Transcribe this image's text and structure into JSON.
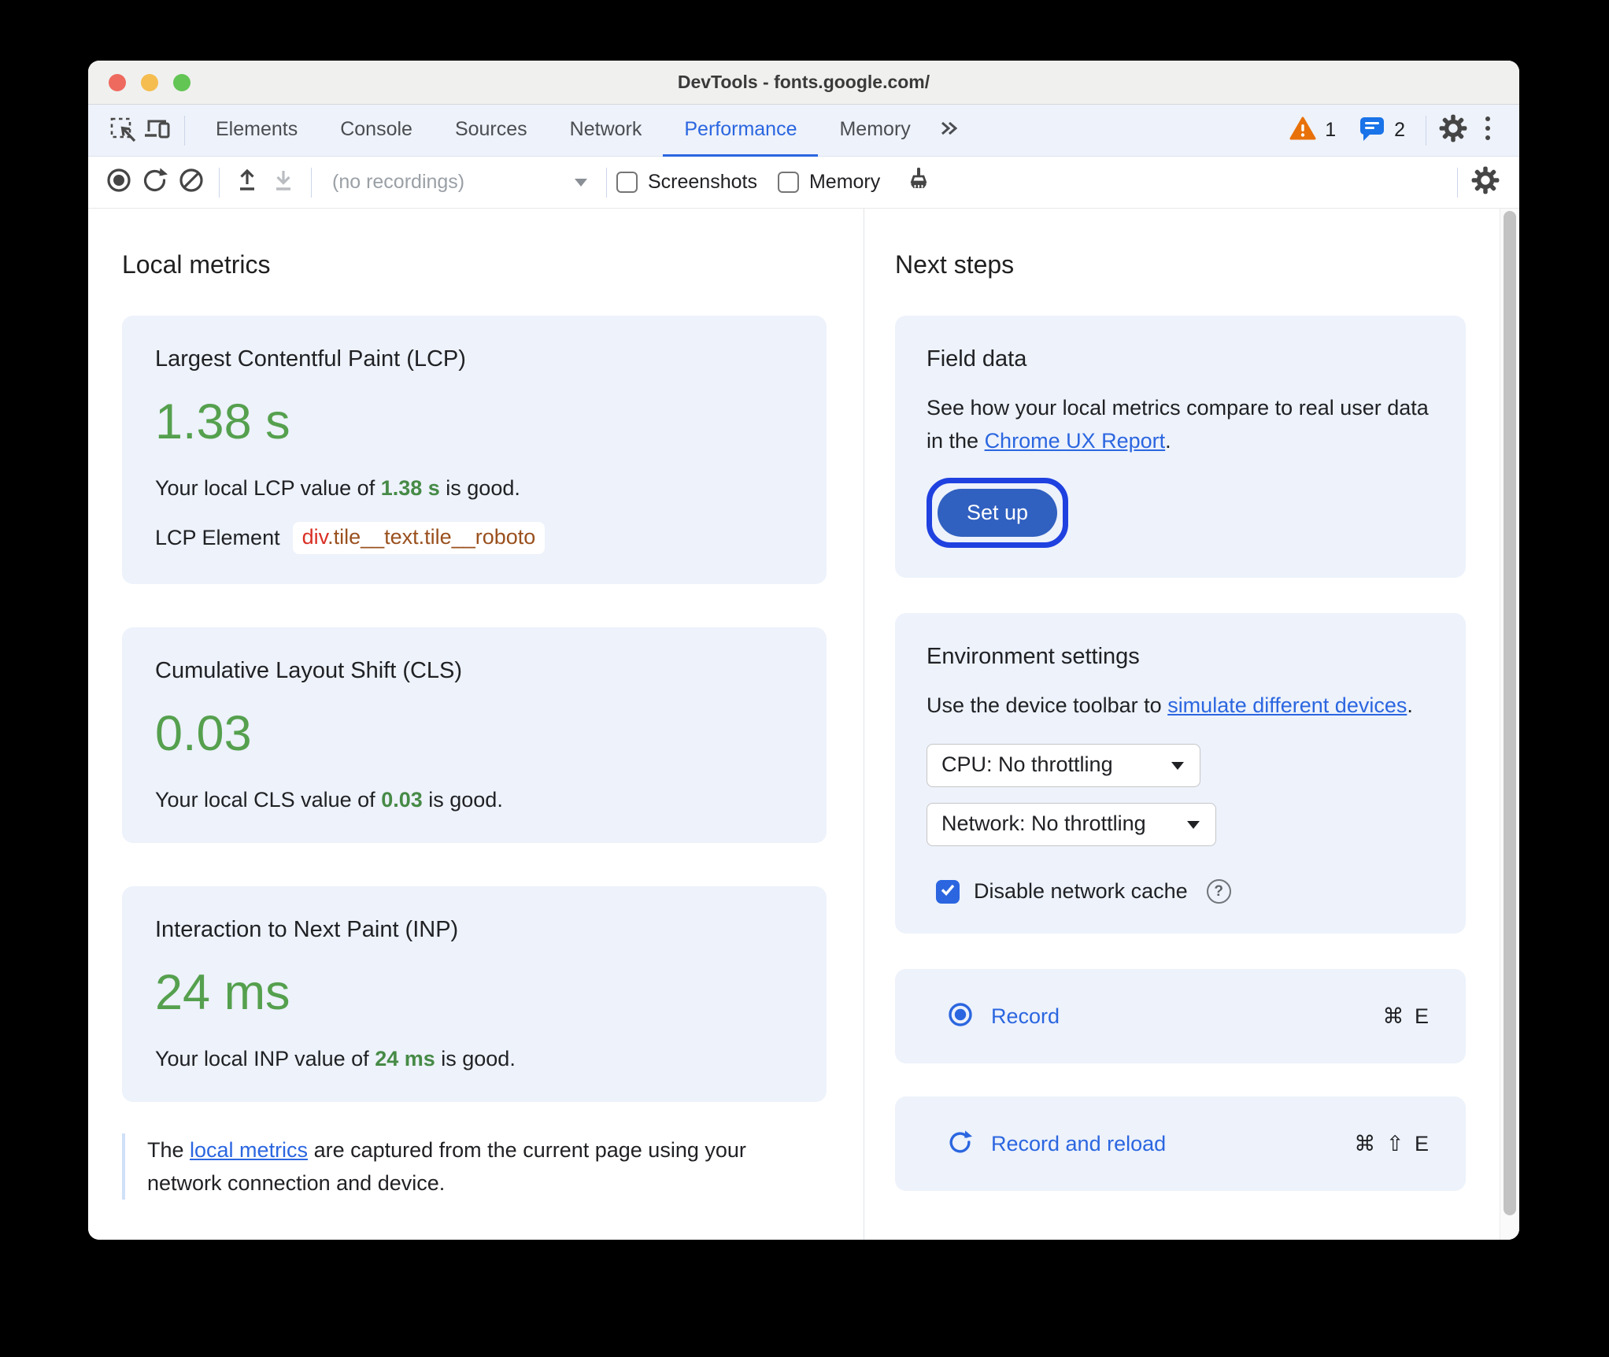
{
  "window": {
    "title": "DevTools - fonts.google.com/"
  },
  "tabbar": {
    "tabs": [
      {
        "label": "Elements"
      },
      {
        "label": "Console"
      },
      {
        "label": "Sources"
      },
      {
        "label": "Network"
      },
      {
        "label": "Performance"
      },
      {
        "label": "Memory"
      }
    ],
    "active_tab": "Performance",
    "warning_count": "1",
    "message_count": "2"
  },
  "toolbar": {
    "recordings_placeholder": "(no recordings)",
    "screenshots_label": "Screenshots",
    "memory_label": "Memory"
  },
  "local_metrics": {
    "heading": "Local metrics",
    "cards": [
      {
        "title": "Largest Contentful Paint (LCP)",
        "value": "1.38 s",
        "desc_prefix": "Your local LCP value of ",
        "desc_value": "1.38 s",
        "desc_suffix": " is good.",
        "element_label": "LCP Element",
        "element_tag": "div",
        "element_classes": ".tile__text.tile__roboto"
      },
      {
        "title": "Cumulative Layout Shift (CLS)",
        "value": "0.03",
        "desc_prefix": "Your local CLS value of ",
        "desc_value": "0.03",
        "desc_suffix": " is good."
      },
      {
        "title": "Interaction to Next Paint (INP)",
        "value": "24 ms",
        "desc_prefix": "Your local INP value of ",
        "desc_value": "24 ms",
        "desc_suffix": " is good."
      }
    ],
    "footnote": {
      "prefix": "The ",
      "link_text": "local metrics",
      "suffix": " are captured from the current page using your network connection and device."
    }
  },
  "next_steps": {
    "heading": "Next steps",
    "field_data": {
      "title": "Field data",
      "body_prefix": "See how your local metrics compare to real user data in the ",
      "link_text": "Chrome UX Report",
      "body_suffix": ".",
      "setup_button_label": "Set up"
    },
    "environment": {
      "title": "Environment settings",
      "body_prefix": "Use the device toolbar to ",
      "link_text": "simulate different devices",
      "body_suffix": ".",
      "cpu_select_value": "CPU: No throttling",
      "network_select_value": "Network: No throttling",
      "disable_cache_label": "Disable network cache",
      "disable_cache_checked": true
    },
    "actions": [
      {
        "label": "Record",
        "shortcut": "⌘ E"
      },
      {
        "label": "Record and reload",
        "shortcut": "⌘ ⇧ E"
      }
    ]
  },
  "icons": {
    "help_glyph": "?"
  },
  "colors": {
    "accent_blue": "#2b66e0",
    "focus_ring_blue": "#1f41e0",
    "button_blue": "#3060c0",
    "good_green": "#55a04e",
    "good_green_inline": "#468a46",
    "card_background": "#edf2fb",
    "tab_bar_background": "#eef2fa",
    "warning_orange": "#e8710a",
    "message_icon_blue": "#1a73e8",
    "element_tag_red": "#d93025",
    "element_class_brown": "#9a501e"
  }
}
